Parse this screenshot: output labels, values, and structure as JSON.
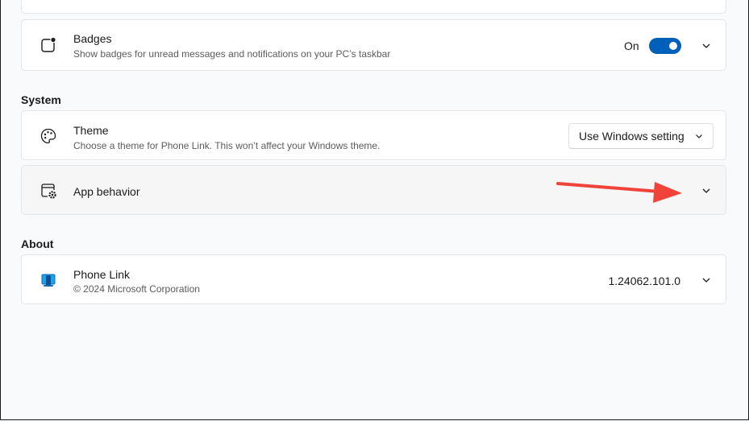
{
  "notifications": {
    "badges": {
      "title": "Badges",
      "description": "Show badges for unread messages and notifications on your PC’s taskbar",
      "toggle_state_label": "On",
      "toggle_on": true,
      "icon": "badge-icon"
    }
  },
  "system": {
    "section_title": "System",
    "theme": {
      "title": "Theme",
      "description": "Choose a theme for Phone Link. This won’t affect your Windows theme.",
      "selected_option": "Use Windows setting",
      "icon": "palette-icon"
    },
    "app_behavior": {
      "title": "App behavior",
      "icon": "app-settings-icon"
    }
  },
  "about": {
    "section_title": "About",
    "phone_link": {
      "title": "Phone Link",
      "description": "© 2024 Microsoft Corporation",
      "version": "1.24062.101.0",
      "icon": "phone-link-icon"
    }
  },
  "colors": {
    "accent": "#005fb8",
    "annotation_arrow": "#f0443a"
  }
}
